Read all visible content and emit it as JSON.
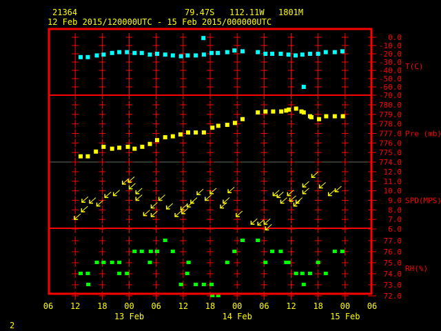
{
  "header": {
    "station": "21364",
    "lat": "79.47S",
    "lon": "112.11W",
    "elev": "1801M",
    "range": "12 Feb 2015/120000UTC - 15 Feb 2015/000000UTC"
  },
  "page_number": "2",
  "colors": {
    "frame": "#ff0000",
    "temp": "#00ffff",
    "pres": "#ffff00",
    "wind": "#ffff00",
    "rh": "#00ff00",
    "text": "#ffff00"
  },
  "chart_data": {
    "type": "scatter",
    "title": "21364 79.47S 112.11W 1801M",
    "subtitle": "12 Feb 2015/120000UTC - 15 Feb 2015/000000UTC",
    "x_unit": "hours since 12 Feb 2015 06UTC",
    "xlim": [
      0,
      72
    ],
    "x_ticks": [
      "06",
      "12",
      "18",
      "00",
      "06",
      "12",
      "18",
      "00",
      "06",
      "12",
      "18",
      "00",
      "06"
    ],
    "x_date_labels": [
      {
        "label": "13 Feb",
        "t": 18
      },
      {
        "label": "14 Feb",
        "t": 42
      },
      {
        "label": "15 Feb",
        "t": 66
      }
    ],
    "panels": [
      {
        "name": "temperature",
        "label": "T(C)",
        "ylim": [
          -70,
          0
        ],
        "ticks": [
          "0.0",
          "-10.0",
          "-20.0",
          "-30.0",
          "-40.0",
          "-50.0",
          "-60.0",
          "-70.0"
        ],
        "points": [
          [
            7.2,
            -24
          ],
          [
            8.8,
            -24
          ],
          [
            10.8,
            -22
          ],
          [
            12.3,
            -21
          ],
          [
            14.2,
            -19
          ],
          [
            15.8,
            -18
          ],
          [
            17.5,
            -18
          ],
          [
            19.2,
            -19
          ],
          [
            20.8,
            -19
          ],
          [
            22.6,
            -21
          ],
          [
            24.2,
            -20
          ],
          [
            26.0,
            -21
          ],
          [
            27.7,
            -22
          ],
          [
            29.5,
            -23
          ],
          [
            31.0,
            -22
          ],
          [
            32.8,
            -22
          ],
          [
            34.6,
            -21
          ],
          [
            34.5,
            -1
          ],
          [
            36.3,
            -19
          ],
          [
            37.7,
            -19
          ],
          [
            39.8,
            -18
          ],
          [
            41.4,
            -16
          ],
          [
            43.2,
            -17
          ],
          [
            46.6,
            -18
          ],
          [
            48.3,
            -20
          ],
          [
            49.8,
            -20
          ],
          [
            51.7,
            -20
          ],
          [
            53.4,
            -21
          ],
          [
            55.0,
            -22
          ],
          [
            56.5,
            -21
          ],
          [
            56.8,
            -60
          ],
          [
            58.2,
            -20
          ],
          [
            60.0,
            -20
          ],
          [
            61.7,
            -18
          ],
          [
            63.7,
            -18
          ],
          [
            65.4,
            -17
          ]
        ]
      },
      {
        "name": "pressure",
        "label": "Pre (mb)",
        "ylim": [
          774,
          780
        ],
        "ticks": [
          "780.0",
          "779.0",
          "778.0",
          "777.0",
          "776.0",
          "775.0",
          "774.0"
        ],
        "points": [
          [
            7.2,
            774.6
          ],
          [
            8.8,
            774.6
          ],
          [
            10.6,
            775.1
          ],
          [
            12.3,
            775.6
          ],
          [
            14.2,
            775.4
          ],
          [
            15.8,
            775.5
          ],
          [
            17.7,
            775.6
          ],
          [
            19.2,
            775.4
          ],
          [
            20.9,
            775.6
          ],
          [
            22.6,
            775.9
          ],
          [
            24.2,
            776.3
          ],
          [
            26.0,
            776.6
          ],
          [
            27.7,
            776.7
          ],
          [
            29.4,
            776.9
          ],
          [
            31.1,
            777.1
          ],
          [
            32.8,
            777.1
          ],
          [
            34.6,
            777.1
          ],
          [
            36.5,
            777.6
          ],
          [
            37.8,
            777.8
          ],
          [
            39.8,
            777.9
          ],
          [
            41.5,
            778.1
          ],
          [
            43.2,
            778.5
          ],
          [
            46.6,
            779.2
          ],
          [
            48.3,
            779.3
          ],
          [
            50.0,
            779.3
          ],
          [
            51.8,
            779.3
          ],
          [
            52.9,
            779.4
          ],
          [
            53.5,
            779.5
          ],
          [
            55.1,
            779.6
          ],
          [
            56.3,
            779.3
          ],
          [
            56.8,
            779.2
          ],
          [
            58.2,
            778.8
          ],
          [
            58.5,
            778.7
          ],
          [
            60.2,
            778.5
          ],
          [
            61.8,
            778.8
          ],
          [
            63.7,
            778.8
          ],
          [
            65.5,
            778.8
          ]
        ]
      },
      {
        "name": "wind_speed",
        "label": "SPD(MPS)",
        "ylim": [
          6,
          12
        ],
        "ticks": [
          "12.0",
          "11.0",
          "10.0",
          "9.0",
          "8.0",
          "7.0",
          "6.0"
        ],
        "points": [
          [
            5.8,
            7.0
          ],
          [
            7.4,
            7.8
          ],
          [
            7.5,
            8.8
          ],
          [
            9.2,
            8.7
          ],
          [
            10.8,
            8.4
          ],
          [
            12.6,
            9.3
          ],
          [
            14.5,
            9.5
          ],
          [
            16.5,
            10.7
          ],
          [
            17.8,
            10.9
          ],
          [
            18.0,
            10.2
          ],
          [
            19.5,
            9.7
          ],
          [
            19.5,
            9.0
          ],
          [
            21.2,
            7.4
          ],
          [
            22.9,
            7.3
          ],
          [
            22.9,
            8.2
          ],
          [
            24.6,
            9.0
          ],
          [
            26.3,
            8.1
          ],
          [
            28.2,
            7.3
          ],
          [
            29.5,
            8.0
          ],
          [
            29.7,
            7.6
          ],
          [
            30.9,
            8.3
          ],
          [
            31.7,
            8.7
          ],
          [
            33.1,
            9.6
          ],
          [
            34.9,
            9.0
          ],
          [
            36.0,
            9.7
          ],
          [
            38.3,
            8.2
          ],
          [
            38.9,
            8.7
          ],
          [
            40.0,
            9.8
          ],
          [
            41.8,
            7.3
          ],
          [
            45.1,
            6.5
          ],
          [
            46.6,
            6.4
          ],
          [
            48.0,
            6.5
          ],
          [
            48.3,
            5.9
          ],
          [
            50.0,
            9.5
          ],
          [
            50.9,
            9.3
          ],
          [
            51.7,
            8.7
          ],
          [
            53.2,
            9.5
          ],
          [
            53.7,
            8.9
          ],
          [
            54.6,
            8.4
          ],
          [
            55.1,
            8.7
          ],
          [
            56.6,
            9.7
          ],
          [
            56.6,
            10.4
          ],
          [
            58.6,
            11.4
          ],
          [
            60.3,
            10.3
          ],
          [
            62.3,
            9.5
          ],
          [
            63.8,
            9.9
          ]
        ]
      },
      {
        "name": "relative_humidity",
        "label": "RH(%)",
        "ylim": [
          72,
          77
        ],
        "ticks": [
          "77.0",
          "76.0",
          "75.0",
          "74.0",
          "73.0",
          "72.0"
        ],
        "points": [
          [
            7.2,
            74
          ],
          [
            8.8,
            74
          ],
          [
            8.9,
            73
          ],
          [
            10.8,
            75
          ],
          [
            12.3,
            75
          ],
          [
            14.2,
            75
          ],
          [
            15.8,
            75
          ],
          [
            15.8,
            74
          ],
          [
            17.5,
            74
          ],
          [
            19.2,
            76
          ],
          [
            20.8,
            76
          ],
          [
            22.6,
            75
          ],
          [
            22.8,
            76
          ],
          [
            24.2,
            76
          ],
          [
            26.0,
            77
          ],
          [
            27.7,
            76
          ],
          [
            29.5,
            73
          ],
          [
            30.9,
            74
          ],
          [
            31.2,
            75
          ],
          [
            32.8,
            73
          ],
          [
            34.6,
            73
          ],
          [
            36.3,
            73
          ],
          [
            36.5,
            72
          ],
          [
            37.8,
            72
          ],
          [
            39.8,
            75
          ],
          [
            41.4,
            76
          ],
          [
            43.2,
            77
          ],
          [
            46.6,
            77
          ],
          [
            48.3,
            75
          ],
          [
            49.8,
            76
          ],
          [
            51.7,
            76
          ],
          [
            52.9,
            75
          ],
          [
            53.4,
            75
          ],
          [
            55.1,
            74
          ],
          [
            56.5,
            74
          ],
          [
            56.8,
            73
          ],
          [
            58.2,
            74
          ],
          [
            60.0,
            75
          ],
          [
            61.7,
            74
          ],
          [
            63.7,
            76
          ],
          [
            65.4,
            76
          ]
        ]
      }
    ]
  }
}
